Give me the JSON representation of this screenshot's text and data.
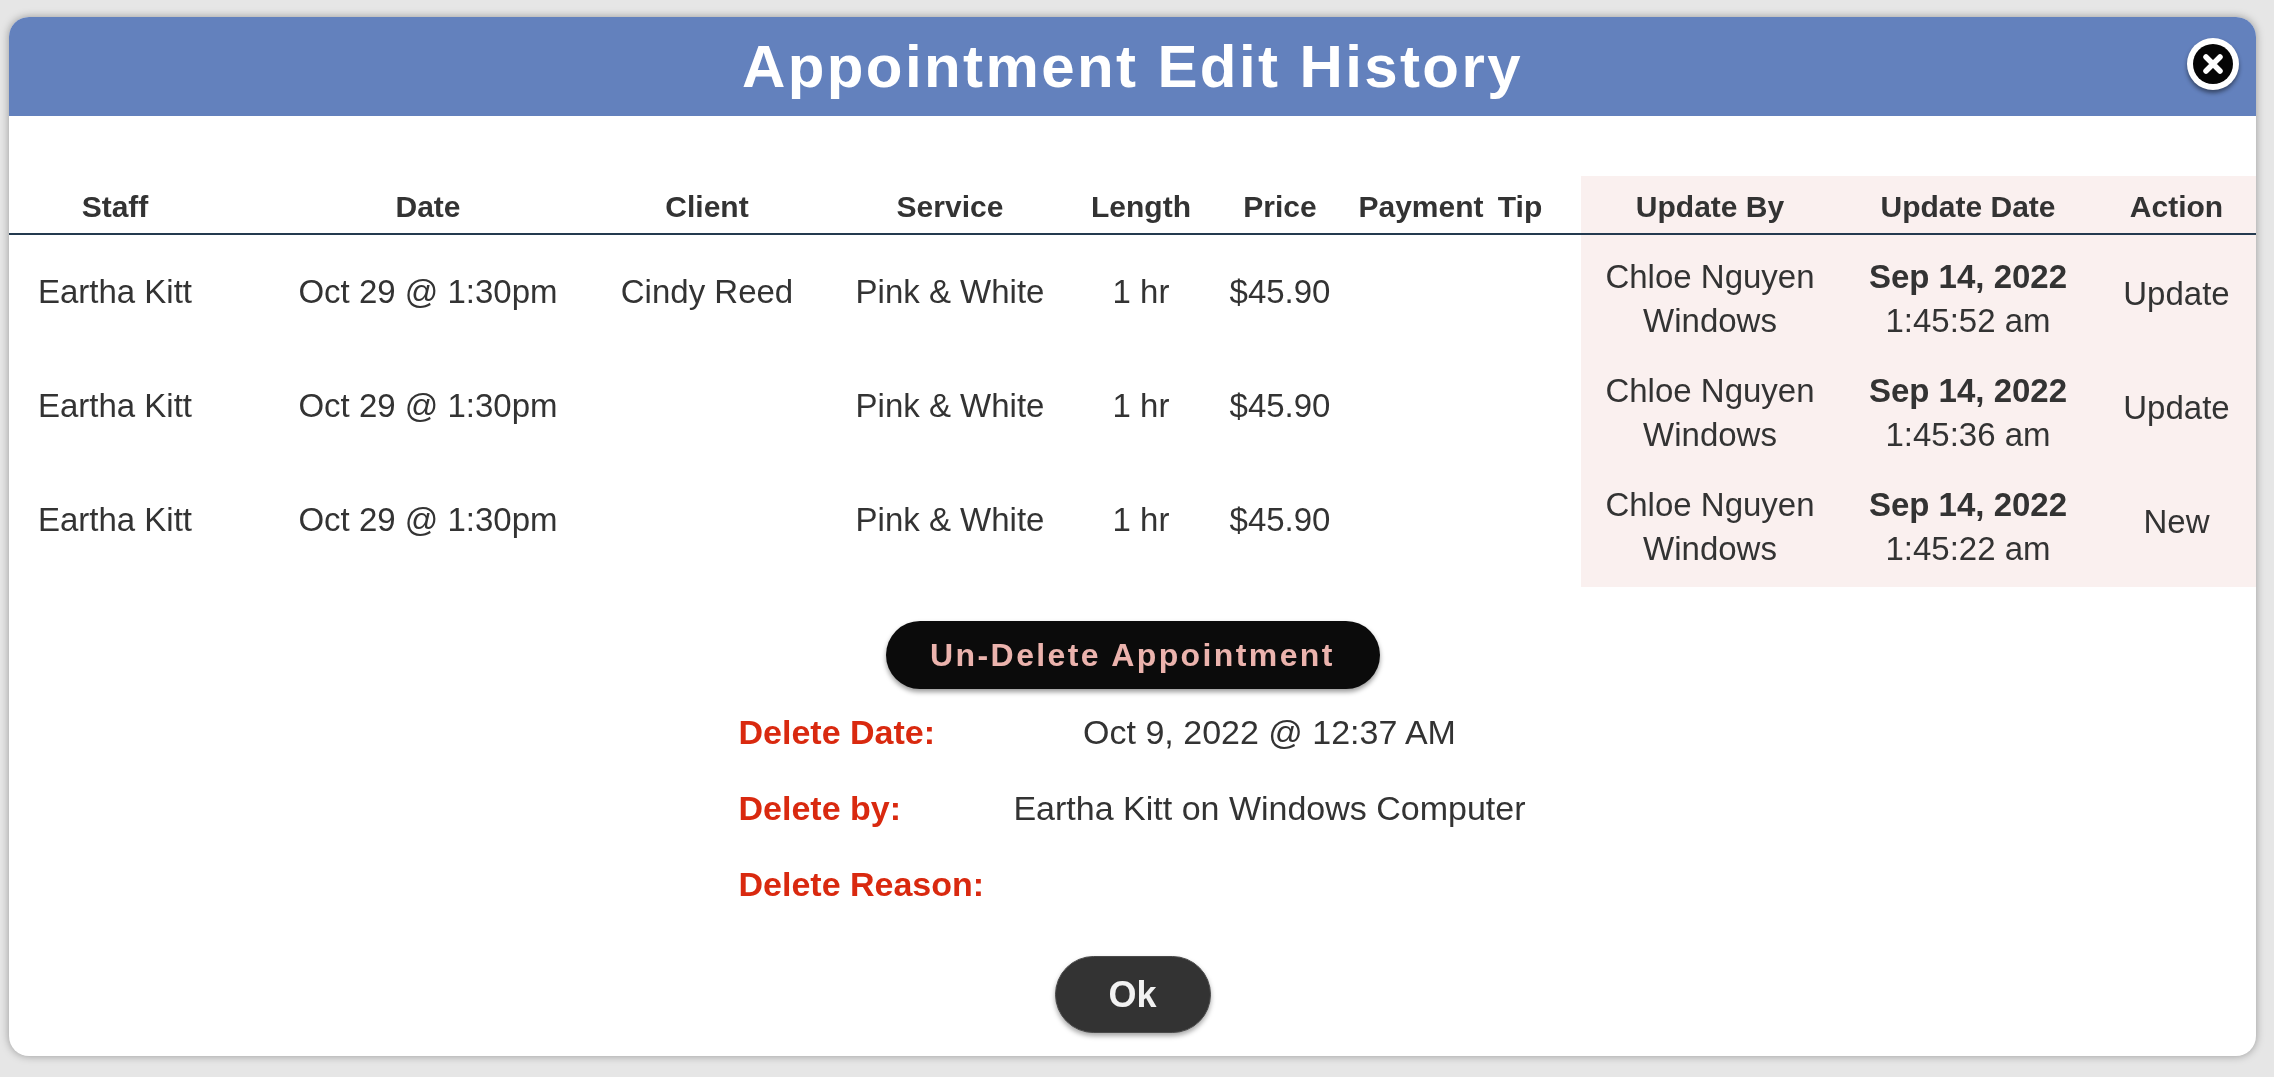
{
  "dialog": {
    "title": "Appointment Edit History"
  },
  "table": {
    "columns": [
      {
        "label": "Staff",
        "highlighted": false
      },
      {
        "label": "Date",
        "highlighted": false
      },
      {
        "label": "Client",
        "highlighted": false
      },
      {
        "label": "Service",
        "highlighted": false
      },
      {
        "label": "Length",
        "highlighted": false
      },
      {
        "label": "Price",
        "highlighted": false
      },
      {
        "label": "Payment",
        "highlighted": false
      },
      {
        "label": "Tip",
        "highlighted": false
      },
      {
        "label": "Update By",
        "highlighted": true
      },
      {
        "label": "Update Date",
        "highlighted": true
      },
      {
        "label": "Action",
        "highlighted": true
      }
    ],
    "rows": [
      {
        "staff": "Eartha Kitt",
        "date": "Oct 29 @ 1:30pm",
        "client": "Cindy Reed",
        "service": "Pink & White",
        "length": "1 hr",
        "price": "$45.90",
        "update_by": {
          "name": "Chloe Nguyen",
          "device": "Windows"
        },
        "update_date": {
          "date": "Sep 14, 2022",
          "time": "1:45:52 am"
        },
        "action": "Update"
      },
      {
        "staff": "Eartha Kitt",
        "date": "Oct 29 @ 1:30pm",
        "service": "Pink & White",
        "length": "1 hr",
        "price": "$45.90",
        "update_by": {
          "name": "Chloe Nguyen",
          "device": "Windows"
        },
        "update_date": {
          "date": "Sep 14, 2022",
          "time": "1:45:36 am"
        },
        "action": "Update"
      },
      {
        "staff": "Eartha Kitt",
        "date": "Oct 29 @ 1:30pm",
        "service": "Pink & White",
        "length": "1 hr",
        "price": "$45.90",
        "update_by": {
          "name": "Chloe Nguyen",
          "device": "Windows"
        },
        "update_date": {
          "date": "Sep 14, 2022",
          "time": "1:45:22 am"
        },
        "action": "New"
      }
    ]
  },
  "undelete_button": "Un-Delete Appointment",
  "delete_info": [
    {
      "label": "Delete Date:",
      "value": "Oct 9, 2022 @ 12:37 AM"
    },
    {
      "label": "Delete by:",
      "value": "Eartha Kitt on Windows Computer"
    },
    {
      "label": "Delete Reason:"
    }
  ],
  "ok_button": "Ok"
}
